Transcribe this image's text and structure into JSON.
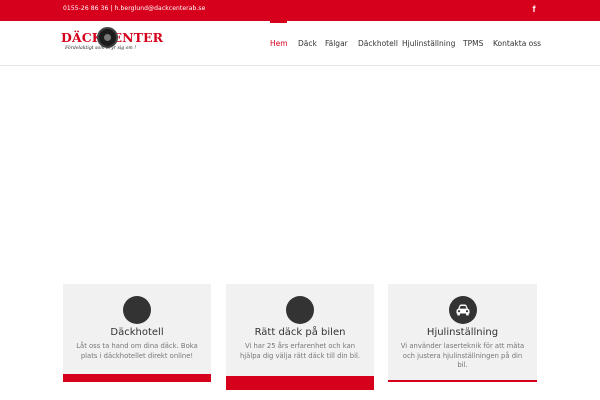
{
  "topbar": {
    "contact": "0155-26 86 36 | h.berglund@dackcenterab.se",
    "social_icon": "facebook-icon"
  },
  "logo": {
    "text": "DÄCKCENTER",
    "tagline": "Fördelaktigt som bryr sig om !"
  },
  "nav": {
    "items": [
      {
        "label": "Hem"
      },
      {
        "label": "Däck"
      },
      {
        "label": "Fälgar"
      },
      {
        "label": "Däckhotell"
      },
      {
        "label": "Hjulinställning"
      },
      {
        "label": "TPMS"
      },
      {
        "label": "Kontakta oss"
      }
    ],
    "active_index": 0
  },
  "cards": [
    {
      "title": "Däckhotell",
      "desc": "Låt oss ta hand om dina däck. Boka plats i däckhotellet direkt online!",
      "icon": "blank-circle-icon"
    },
    {
      "title": "Rätt däck på bilen",
      "desc": "Vi har 25 års erfarenhet och kan hjälpa dig välja rätt däck till din bil.",
      "icon": "blank-circle-icon"
    },
    {
      "title": "Hjulinställning",
      "desc": "Vi använder laserteknik för att mäta och justera hjulinställningen på din bil.",
      "icon": "car-icon"
    }
  ],
  "colors": {
    "brand_red": "#d6001c",
    "card_bg": "#f1f1f1",
    "icon_circle": "#333333"
  }
}
